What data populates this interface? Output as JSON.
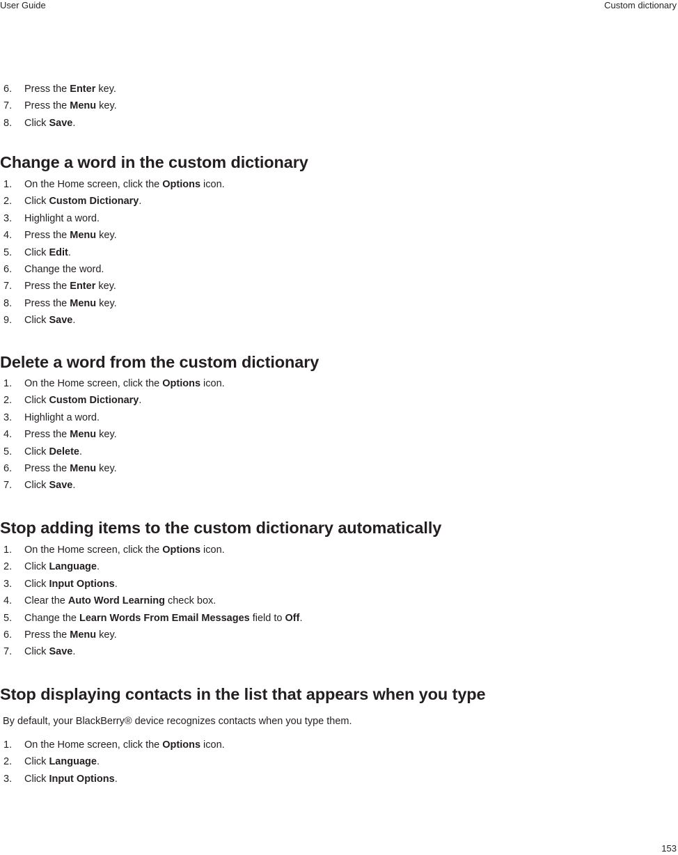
{
  "header": {
    "left": "User Guide",
    "right": "Custom dictionary"
  },
  "page_number": "153",
  "continued_steps": [
    {
      "num": "6.",
      "pre": "Press the ",
      "bold": "Enter",
      "post": " key."
    },
    {
      "num": "7.",
      "pre": "Press the ",
      "bold": "Menu",
      "post": " key."
    },
    {
      "num": "8.",
      "pre": "Click ",
      "bold": "Save",
      "post": "."
    }
  ],
  "sections": [
    {
      "title": "Change a word in the custom dictionary",
      "steps": [
        {
          "num": "1.",
          "pre": "On the Home screen, click the ",
          "bold": "Options",
          "post": " icon."
        },
        {
          "num": "2.",
          "pre": "Click ",
          "bold": "Custom Dictionary",
          "post": "."
        },
        {
          "num": "3.",
          "pre": "Highlight a word.",
          "bold": "",
          "post": ""
        },
        {
          "num": "4.",
          "pre": "Press the ",
          "bold": "Menu",
          "post": " key."
        },
        {
          "num": "5.",
          "pre": "Click ",
          "bold": "Edit",
          "post": "."
        },
        {
          "num": "6.",
          "pre": "Change the word.",
          "bold": "",
          "post": ""
        },
        {
          "num": "7.",
          "pre": "Press the ",
          "bold": "Enter",
          "post": " key."
        },
        {
          "num": "8.",
          "pre": "Press the ",
          "bold": "Menu",
          "post": " key."
        },
        {
          "num": "9.",
          "pre": "Click ",
          "bold": "Save",
          "post": "."
        }
      ]
    },
    {
      "title": "Delete a word from the custom dictionary",
      "steps": [
        {
          "num": "1.",
          "pre": "On the Home screen, click the ",
          "bold": "Options",
          "post": " icon."
        },
        {
          "num": "2.",
          "pre": "Click ",
          "bold": "Custom Dictionary",
          "post": "."
        },
        {
          "num": "3.",
          "pre": "Highlight a word.",
          "bold": "",
          "post": ""
        },
        {
          "num": "4.",
          "pre": "Press the ",
          "bold": "Menu",
          "post": " key."
        },
        {
          "num": "5.",
          "pre": "Click ",
          "bold": "Delete",
          "post": "."
        },
        {
          "num": "6.",
          "pre": "Press the ",
          "bold": "Menu",
          "post": " key."
        },
        {
          "num": "7.",
          "pre": "Click ",
          "bold": "Save",
          "post": "."
        }
      ]
    },
    {
      "title": "Stop adding items to the custom dictionary automatically",
      "steps": [
        {
          "num": "1.",
          "pre": "On the Home screen, click the ",
          "bold": "Options",
          "post": " icon."
        },
        {
          "num": "2.",
          "pre": "Click ",
          "bold": "Language",
          "post": "."
        },
        {
          "num": "3.",
          "pre": "Click ",
          "bold": "Input Options",
          "post": "."
        },
        {
          "num": "4.",
          "pre": "Clear the ",
          "bold": "Auto Word Learning",
          "post": " check box."
        },
        {
          "num": "5.",
          "pre": "Change the ",
          "bold": "Learn Words From Email Messages",
          "post": " field to ",
          "bold2": "Off",
          "post2": "."
        },
        {
          "num": "6.",
          "pre": "Press the ",
          "bold": "Menu",
          "post": " key."
        },
        {
          "num": "7.",
          "pre": "Click ",
          "bold": "Save",
          "post": "."
        }
      ]
    },
    {
      "title": "Stop displaying contacts in the list that appears when you type",
      "intro": "By default, your BlackBerry® device recognizes contacts when you type them.",
      "steps": [
        {
          "num": "1.",
          "pre": "On the Home screen, click the ",
          "bold": "Options",
          "post": " icon."
        },
        {
          "num": "2.",
          "pre": "Click ",
          "bold": "Language",
          "post": "."
        },
        {
          "num": "3.",
          "pre": "Click ",
          "bold": "Input Options",
          "post": "."
        }
      ]
    }
  ]
}
